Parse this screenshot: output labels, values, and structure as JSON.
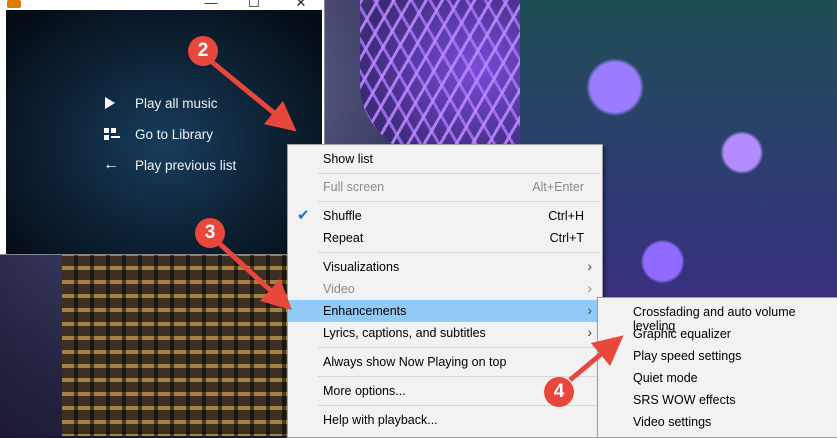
{
  "window": {
    "minimize_glyph": "—",
    "maximize_glyph": "☐",
    "close_glyph": "✕"
  },
  "player_items": [
    {
      "label": "Play all music",
      "icon": "play-icon"
    },
    {
      "label": "Go to Library",
      "icon": "library-icon"
    },
    {
      "label": "Play previous list",
      "icon": "back-arrow-icon"
    }
  ],
  "context_menu": {
    "show_list": "Show list",
    "full_screen": "Full screen",
    "full_screen_shortcut": "Alt+Enter",
    "shuffle": "Shuffle",
    "shuffle_shortcut": "Ctrl+H",
    "repeat": "Repeat",
    "repeat_shortcut": "Ctrl+T",
    "visualizations": "Visualizations",
    "video": "Video",
    "enhancements": "Enhancements",
    "lyrics": "Lyrics, captions, and subtitles",
    "always_on_top": "Always show Now Playing on top",
    "more_options": "More options...",
    "help": "Help with playback..."
  },
  "submenu": [
    "Crossfading and auto volume leveling",
    "Graphic equalizer",
    "Play speed settings",
    "Quiet mode",
    "SRS WOW effects",
    "Video settings"
  ],
  "annotations": {
    "step2": "2",
    "step3": "3",
    "step4": "4"
  },
  "colors": {
    "highlight": "#91c9f7",
    "annotation": "#e8483c",
    "check": "#1f6fd1"
  }
}
